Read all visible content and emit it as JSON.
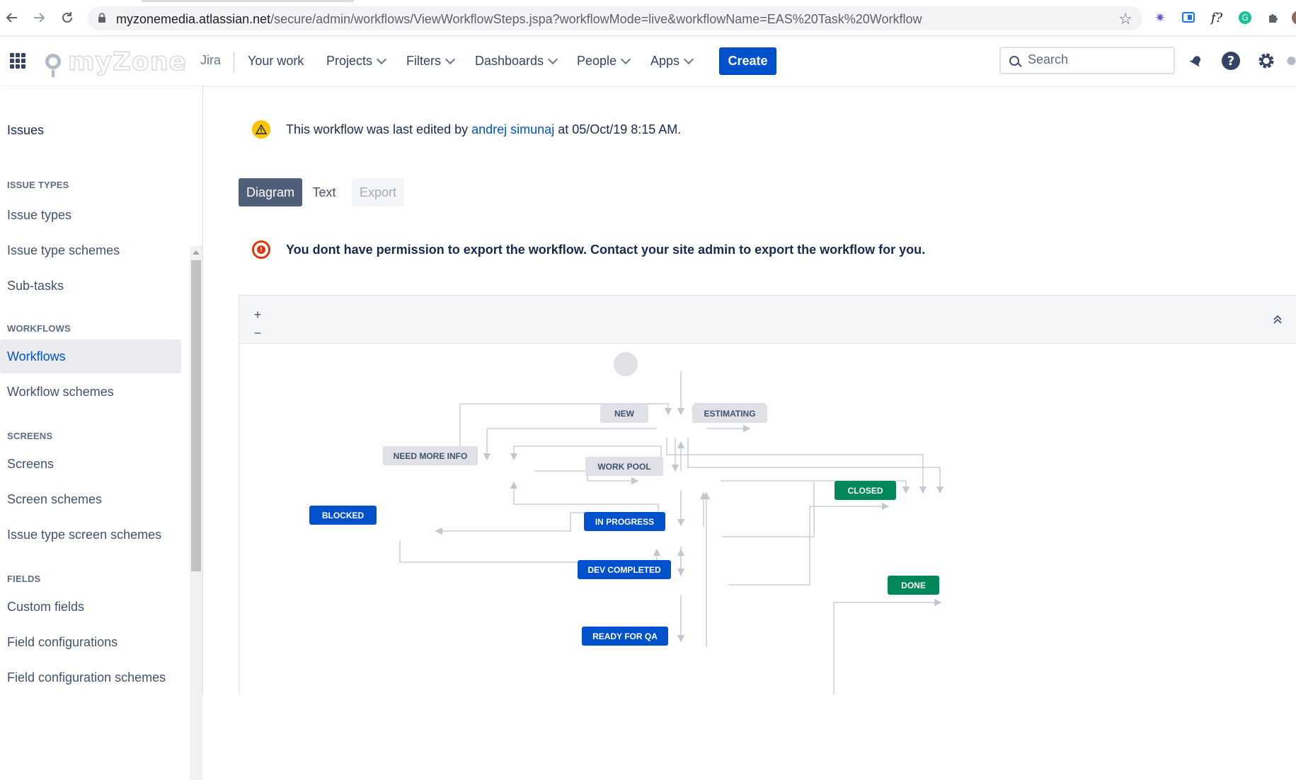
{
  "browser": {
    "url_host": "myzonemedia.atlassian.net",
    "url_path": "/secure/admin/workflows/ViewWorkflowSteps.jspa?workflowMode=live&workflowName=EAS%20Task%20Workflow",
    "icons": [
      "back-icon",
      "forward-icon",
      "reload-icon",
      "lock-icon",
      "star-icon",
      "extension-icons"
    ]
  },
  "topnav": {
    "logo_text": "myZone",
    "product": "Jira",
    "items": [
      {
        "label": "Your work",
        "dropdown": false
      },
      {
        "label": "Projects",
        "dropdown": true
      },
      {
        "label": "Filters",
        "dropdown": true
      },
      {
        "label": "Dashboards",
        "dropdown": true
      },
      {
        "label": "People",
        "dropdown": true
      },
      {
        "label": "Apps",
        "dropdown": true
      }
    ],
    "create_label": "Create",
    "search_placeholder": "Search"
  },
  "sidebar": {
    "title": "Issues",
    "sections": [
      {
        "heading": "ISSUE TYPES",
        "items": [
          "Issue types",
          "Issue type schemes",
          "Sub-tasks"
        ]
      },
      {
        "heading": "WORKFLOWS",
        "items": [
          "Workflows",
          "Workflow schemes"
        ]
      },
      {
        "heading": "SCREENS",
        "items": [
          "Screens",
          "Screen schemes",
          "Issue type screen schemes"
        ]
      },
      {
        "heading": "FIELDS",
        "items": [
          "Custom fields",
          "Field configurations",
          "Field configuration schemes"
        ]
      }
    ],
    "active_item": "Workflows"
  },
  "main": {
    "notice_prefix": "This workflow was last edited by",
    "notice_user": "andrej simunaj",
    "notice_suffix": "at 05/Oct/19 8:15 AM.",
    "tabs": {
      "diagram": "Diagram",
      "text": "Text",
      "export": "Export"
    },
    "error_text": "You dont have permission to export the workflow. Contact your site admin to export the workflow for you.",
    "zoom_in": "+",
    "zoom_out": "−"
  },
  "workflow": {
    "statuses": {
      "new": "NEW",
      "estimating": "ESTIMATING",
      "need_more_info": "NEED MORE INFO",
      "work_pool": "WORK POOL",
      "closed": "CLOSED",
      "blocked": "BLOCKED",
      "in_progress": "IN PROGRESS",
      "dev_completed": "DEV COMPLETED",
      "done": "DONE",
      "ready_for_qa": "READY FOR QA"
    },
    "colors": {
      "todo": "#dfe1e6",
      "in_progress": "#0052cc",
      "done": "#00875a",
      "line": "#c1c7d0"
    }
  }
}
